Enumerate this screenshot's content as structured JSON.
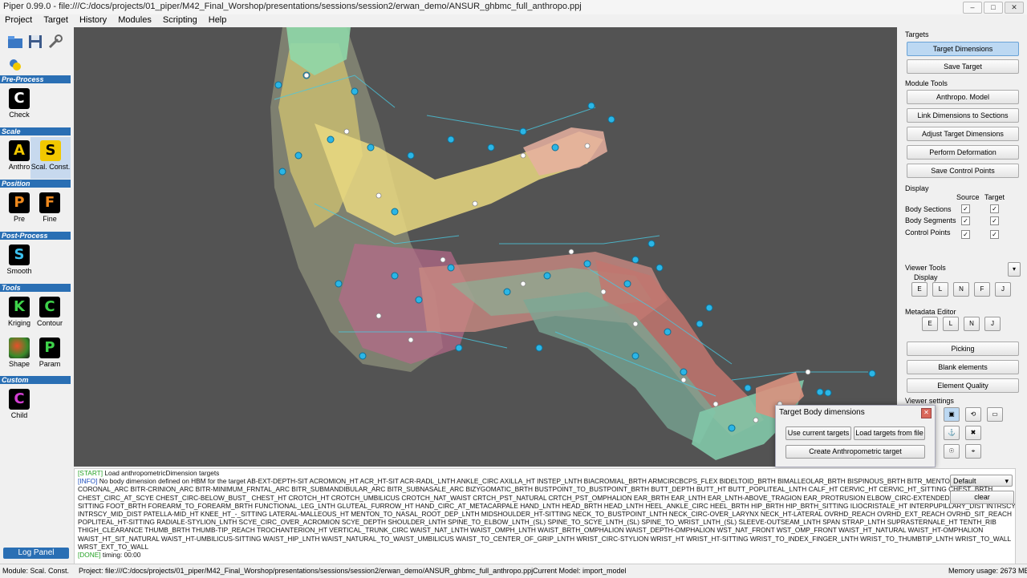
{
  "window": {
    "title": "Piper 0.99.0 - file:///C:/docs/projects/01_piper/M42_Final_Worshop/presentations/sessions/session2/erwan_demo/ANSUR_ghbmc_full_anthropo.ppj",
    "min": "–",
    "max": "□",
    "close": "✕"
  },
  "menu": [
    "Project",
    "Target",
    "History",
    "Modules",
    "Scripting",
    "Help"
  ],
  "left": {
    "categories": {
      "preprocess": "Pre-Process",
      "scale": "Scale",
      "position": "Position",
      "postprocess": "Post-Process",
      "tools": "Tools",
      "custom": "Custom"
    },
    "modules": {
      "check": {
        "glyph": "C",
        "label": "Check",
        "color": "#ffffff"
      },
      "anthro": {
        "glyph": "A",
        "label": "Anthro",
        "color": "#f2c800"
      },
      "scalconst": {
        "glyph": "S",
        "label": "Scal. Const.",
        "color": "#f2c800"
      },
      "pre": {
        "glyph": "P",
        "label": "Pre",
        "color": "#f08a1e"
      },
      "fine": {
        "glyph": "F",
        "label": "Fine",
        "color": "#f08a1e"
      },
      "smooth": {
        "glyph": "S",
        "label": "Smooth",
        "color": "#3cc2f0"
      },
      "kriging": {
        "glyph": "K",
        "label": "Kriging",
        "color": "#3ed24a"
      },
      "contour": {
        "glyph": "C",
        "label": "Contour",
        "color": "#3ed24a"
      },
      "shape": {
        "glyph": "",
        "label": "Shape",
        "color": "#3ed24a"
      },
      "param": {
        "glyph": "P",
        "label": "Param",
        "color": "#3ed24a"
      },
      "child": {
        "glyph": "C",
        "label": "Child",
        "color": "#d23ed2"
      }
    },
    "log_panel": "Log Panel"
  },
  "right": {
    "targets_header": "Targets",
    "target_dimensions": "Target Dimensions",
    "save_target": "Save Target",
    "module_tools_header": "Module Tools",
    "anthropo_model": "Anthropo. Model",
    "link_dimensions": "Link Dimensions to Sections",
    "adjust_target": "Adjust Target Dimensions",
    "perform_deformation": "Perform Deformation",
    "save_control_points": "Save Control Points",
    "display_header": "Display",
    "col_source": "Source",
    "col_target": "Target",
    "rows": [
      "Body Sections",
      "Body Segments",
      "Control Points"
    ],
    "check": "✓",
    "viewer_tools_header": "Viewer Tools",
    "viewer_display": "Display",
    "viewer_buttons": [
      "E",
      "L",
      "N",
      "F",
      "J"
    ],
    "metadata_header": "Metadata Editor",
    "metadata_buttons": [
      "E",
      "L",
      "N",
      "J"
    ],
    "picking": "Picking",
    "blank_elements": "Blank elements",
    "element_quality": "Element Quality",
    "viewer_settings": "Viewer settings"
  },
  "dialog": {
    "title": "Target Body dimensions",
    "use_current": "Use current targets",
    "load_targets": "Load targets from file",
    "create": "Create Anthropometric target",
    "close": "✕"
  },
  "console": {
    "lines": [
      {
        "tag": "[START]",
        "text": "Load anthropometricDimension targets"
      },
      {
        "tag": "[INFO]",
        "text": "No body dimension defined on HBM for the target AB-EXT-DEPTH-SIT ACROMION_HT ACR_HT-SIT ACR-RADL_LNTH ANKLE_CIRC AXILLA_HT INSTEP_LNTH BIACROMIAL_BRTH ARMCIRCBCPS_FLEX BIDELTOID_BRTH BIMALLEOLAR_BRTH BISPINOUS_BRTH BITR_MENTON_A"
      },
      {
        "tag": "",
        "text": "CORONAL_ARC BITR-CRINION_ARC BITR-MINIMUM_FRNTAL_ARC BITR_SUBMANDIBULAR_ARC BITR_SUBNASALE_ARC BIZYGOMATIC_BRTH BUSTPOINT_TO_BUSTPOINT_BRTH BUTT_DEPTH BUTT_HT BUTT_POPLITEAL_LNTH CALF_HT CERVIC_HT CERVIC_HT_SITTING CHEST_BRTH"
      },
      {
        "tag": "",
        "text": "CHEST_CIRC_AT_SCYE CHEST_CIRC-BELOW_BUST_ CHEST_HT CROTCH_HT CROTCH_UMBILICUS CROTCH_NAT_WAIST CRTCH_PST_NATURAL CRTCH_PST_OMPHALION EAR_BRTH EAR_LNTH EAR_LNTH-ABOVE_TRAGION EAR_PROTRUSION ELBOW_CIRC-EXTENDED ELBOW_RES"
      },
      {
        "tag": "",
        "text": "SITTING FOOT_BRTH FOREARM_TO_FOREARM_BRTH FUNCTIONAL_LEG_LNTH GLUTEAL_FURROW_HT HAND_CIRC_AT_METACARPALE HAND_LNTH HEAD_BRTH HEAD_LNTH HEEL_ANKLE_CIRC HEEL_BRTH HIP_BRTH HIP_BRTH_SITTING ILIOCRISTALE_HT INTERPUPILLARY_DIST INTRSCY_DIST"
      },
      {
        "tag": "",
        "text": "INTRSCY_MID_DIST PATELLA-MID_HT KNEE_HT_-_SITTING LATERAL-MALLEOUS_HT MENTON_TO_NASAL_ROOT_DEP_LNTH MIDSHOULDER_HT-SITTING NECK_TO_BUSTPOINT_LNTH NECK_CIRC-OVER_LARYNX NECK_HT-LATERAL OVRHD_REACH OVRHD_EXT_REACH OVRHD_SIT_REACH"
      },
      {
        "tag": "",
        "text": "POPLITEAL_HT-SITTING RADIALE-STYLION_LNTH SCYE_CIRC_OVER_ACROMION SCYE_DEPTH SHOULDER_LNTH SPINE_TO_ELBOW_LNTH_(SL) SPINE_TO_SCYE_LNTH_(SL) SPINE_TO_WRIST_LNTH_(SL) SLEEVE-OUTSEAM_LNTH SPAN STRAP_LNTH SUPRASTERNALE_HT TENTH_RIB"
      },
      {
        "tag": "",
        "text": "THIGH_CLEARANCE THUMB_BRTH THUMB-TIP_REACH TROCHANTERION_HT VERTICAL_TRUNK_CIRC WAIST_NAT_LNTH WAIST_OMPH_LNTH WAIST_BRTH_OMPHALION WAIST_DEPTH-OMPHALION WST_NAT_FRONT WST_OMP_FRONT WAIST_HT_NATURAL WAIST_HT-OMPHALION"
      },
      {
        "tag": "",
        "text": "WAIST_HT_SIT_NATURAL WAIST_HT-UMBILICUS-SITTING WAIST_HIP_LNTH WAIST_NATURAL_TO_WAIST_UMBILICUS WAIST_TO_CENTER_OF_GRIP_LNTH WRIST_CIRC-STYLION WRIST_HT WRIST_HT-SITTING WRIST_TO_INDEX_FINGER_LNTH WRIST_TO_THUMBTIP_LNTH WRIST_TO_WALL"
      },
      {
        "tag": "",
        "text": "WRST_EXT_TO_WALL"
      },
      {
        "tag": "[DONE]",
        "text": "timing: 00:00"
      }
    ],
    "level_select": "Default",
    "clear": "clear"
  },
  "status": {
    "module": "Module: Scal. Const.",
    "project": "Project: file:///C:/docs/projects/01_piper/M42_Final_Worshop/presentations/sessions/session2/erwan_demo/ANSUR_ghbmc_full_anthropo.ppj",
    "model": "Current Model: import_model",
    "memory": "Memory usage: 2673 MB"
  }
}
